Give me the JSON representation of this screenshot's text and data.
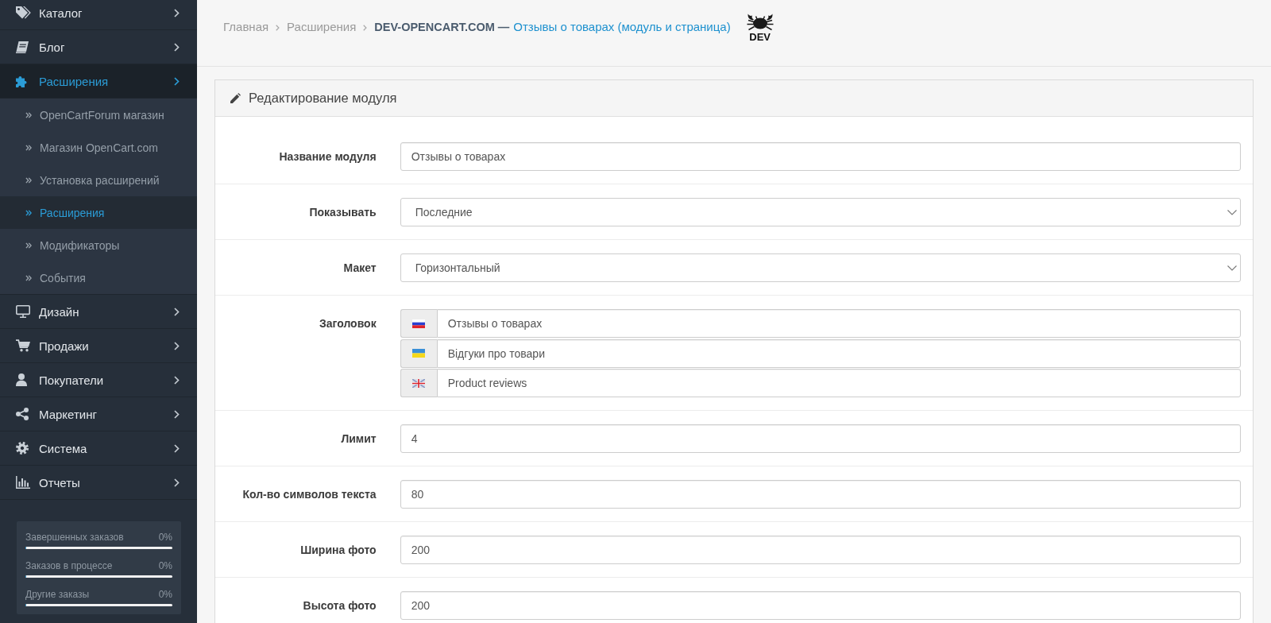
{
  "sidebar": {
    "menu": [
      {
        "label": "Каталог",
        "selected": false
      },
      {
        "label": "Блог",
        "selected": false
      },
      {
        "label": "Расширения",
        "selected": true,
        "children": [
          {
            "label": "OpenCartForum магазин",
            "selected": false
          },
          {
            "label": "Магазин OpenCart.com",
            "selected": false
          },
          {
            "label": "Установка расширений",
            "selected": false
          },
          {
            "label": "Расширения",
            "selected": true
          },
          {
            "label": "Модификаторы",
            "selected": false
          },
          {
            "label": "События",
            "selected": false
          }
        ]
      },
      {
        "label": "Дизайн",
        "selected": false
      },
      {
        "label": "Продажи",
        "selected": false
      },
      {
        "label": "Покупатели",
        "selected": false
      },
      {
        "label": "Маркетинг",
        "selected": false
      },
      {
        "label": "Система",
        "selected": false
      },
      {
        "label": "Отчеты",
        "selected": false
      }
    ],
    "stats": [
      {
        "label": "Завершенных заказов",
        "reading": "0%",
        "level": 0
      },
      {
        "label": "Заказов в процессе",
        "reading": "0%",
        "level": 0
      },
      {
        "label": "Другие заказы",
        "reading": "0%",
        "level": 0
      }
    ]
  },
  "breadcrumb": {
    "items": [
      {
        "label": "Главная"
      },
      {
        "label": "Расширения"
      }
    ],
    "current": {
      "prefix": "DEV-OPENCART.COM —",
      "label": "Отзывы о товарах (модуль и страница)"
    },
    "logo": {
      "text": "DEV"
    }
  },
  "panel": {
    "title": "Редактирование модуля",
    "fields": [
      {
        "kind": "text",
        "label": "Название модуля",
        "value": "Отзывы о товарах"
      },
      {
        "kind": "select",
        "label": "Показывать",
        "value": "Последние"
      },
      {
        "kind": "select",
        "label": "Макет",
        "value": "Горизонтальный"
      },
      {
        "kind": "multilang",
        "label": "Заголовок",
        "entries": [
          {
            "value": "Отзывы о товарах"
          },
          {
            "value": "Відгуки про товари"
          },
          {
            "value": "Product reviews"
          }
        ]
      },
      {
        "kind": "text",
        "label": "Лимит",
        "value": "4"
      },
      {
        "kind": "text",
        "label": "Кол-во символов текста",
        "value": "80"
      },
      {
        "kind": "text",
        "label": "Ширина фото",
        "value": "200"
      },
      {
        "kind": "text",
        "label": "Высота фото",
        "value": "200"
      }
    ]
  }
}
